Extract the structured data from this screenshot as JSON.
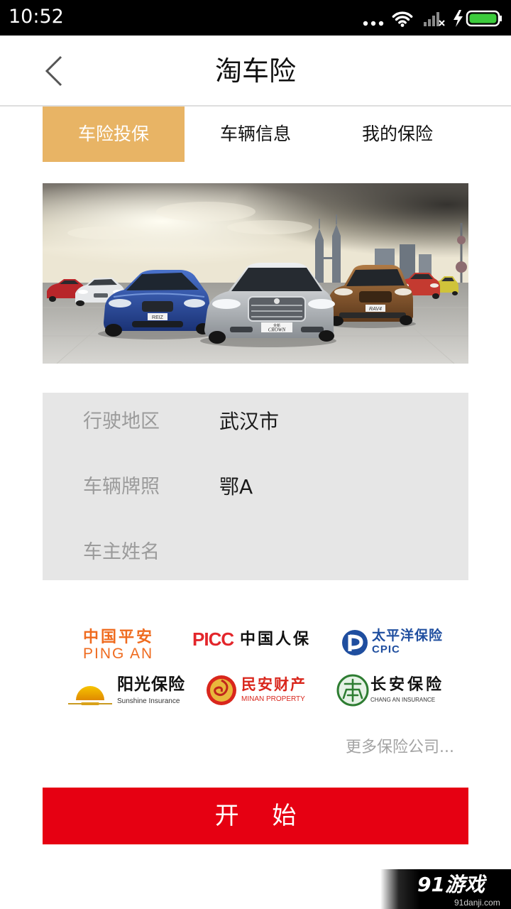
{
  "status_bar": {
    "time": "10:52",
    "icons": [
      "more-dots-icon",
      "wifi-icon",
      "signal-icon",
      "charging-icon",
      "battery-icon"
    ]
  },
  "header": {
    "title": "淘车险",
    "back_icon": "chevron-left-icon"
  },
  "tabs": [
    {
      "label": "车险投保",
      "active": true
    },
    {
      "label": "车辆信息",
      "active": false
    },
    {
      "label": "我的保险",
      "active": false
    }
  ],
  "banner": {
    "plate_texts": [
      "REIZ",
      "全新",
      "CROWN",
      "RAV4"
    ]
  },
  "form": {
    "rows": [
      {
        "label": "行驶地区",
        "value": "武汉市"
      },
      {
        "label": "车辆牌照",
        "value": "鄂A"
      },
      {
        "label": "车主姓名",
        "value": ""
      }
    ]
  },
  "insurers": [
    {
      "name_cn": "中国平安",
      "name_en": "PING AN"
    },
    {
      "name_cn": "中国人保",
      "name_en": "PICC"
    },
    {
      "name_cn": "太平洋保险",
      "name_en": "CPIC"
    },
    {
      "name_cn": "阳光保险",
      "name_en": "Sunshine Insurance"
    },
    {
      "name_cn": "民安财产",
      "name_en": "MINAN PROPERTY"
    },
    {
      "name_cn": "长安保险",
      "name_en": "CHANG AN INSURANCE"
    }
  ],
  "more_link": "更多保险公司...",
  "start_button": "开 始",
  "watermark": {
    "logo": "91游戏",
    "site": "91danji.com"
  },
  "colors": {
    "tab_active_bg": "#E8B465",
    "start_button_bg": "#E60012",
    "form_bg": "#E6E6E6",
    "battery_fill": "#3CCB3C",
    "pingan_orange": "#EF6B1F",
    "picc_red": "#E3262B",
    "cpic_blue": "#1F4E9F",
    "minan_red": "#D9261C",
    "changan_green": "#2E7D32"
  }
}
